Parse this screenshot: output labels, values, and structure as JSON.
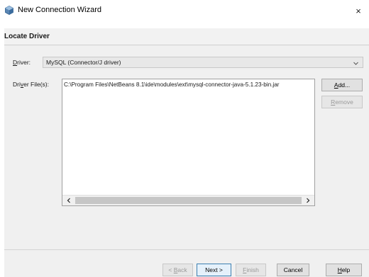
{
  "window": {
    "title": "New Connection Wizard",
    "close_glyph": "×"
  },
  "header": {
    "step_title": "Locate Driver"
  },
  "form": {
    "driver_label_hotkey": "D",
    "driver_label_rest": "river:",
    "driver_value": "MySQL (Connector/J driver)",
    "files_label_pre": "Dri",
    "files_label_hotkey": "v",
    "files_label_post": "er File(s):",
    "files": [
      "C:\\Program Files\\NetBeans 8.1\\ide\\modules\\ext\\mysql-connector-java-5.1.23-bin.jar"
    ],
    "add_button_hotkey": "A",
    "add_button_rest": "dd...",
    "remove_button_hotkey": "R",
    "remove_button_rest": "emove"
  },
  "footer": {
    "back_pre": "< ",
    "back_hotkey": "B",
    "back_rest": "ack",
    "next_label": "Next >",
    "finish_hotkey": "F",
    "finish_rest": "inish",
    "cancel_label": "Cancel",
    "help_hotkey": "H",
    "help_rest": "elp"
  },
  "icons": {
    "app": "netbeans-cube-icon",
    "dropdown": "chevron-down-icon",
    "scroll_left": "scroll-left-arrow-icon",
    "scroll_right": "scroll-right-arrow-icon"
  },
  "colors": {
    "accent": "#3c7fb1",
    "icon_blue": "#2f5f8f"
  }
}
